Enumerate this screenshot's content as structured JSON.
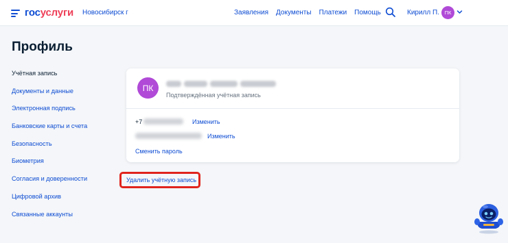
{
  "header": {
    "logo_part1": "гос",
    "logo_part2": "услуги",
    "city": "Новосибирск г",
    "nav": [
      "Заявления",
      "Документы",
      "Платежи",
      "Помощь"
    ],
    "user_name": "Кирилл П.",
    "user_initials": "ПК",
    "icons": {
      "menu": "menu-icon",
      "search": "search-icon",
      "chevron": "chevron-down-icon"
    }
  },
  "page": {
    "title": "Профиль"
  },
  "sidebar": {
    "items": [
      {
        "label": "Учётная запись",
        "active": true
      },
      {
        "label": "Документы и данные"
      },
      {
        "label": "Электронная подпись"
      },
      {
        "label": "Банковские карты и счета"
      },
      {
        "label": "Безопасность"
      },
      {
        "label": "Биометрия"
      },
      {
        "label": "Согласия и доверенности"
      },
      {
        "label": "Цифровой архив"
      },
      {
        "label": "Связанные аккаунты"
      }
    ]
  },
  "profile_card": {
    "initials": "ПК",
    "status": "Подтверждённая учётная запись",
    "phone_prefix": "+7",
    "edit_phone": "Изменить",
    "edit_email": "Изменить",
    "change_password": "Сменить пароль"
  },
  "actions": {
    "delete_account": "Удалить учётную запись"
  },
  "colors": {
    "brand_blue": "#0d4cd3",
    "brand_red": "#ee3f58",
    "avatar_purple": "#b04ad7",
    "highlight_red": "#e0241d",
    "background": "#f4f6f9"
  }
}
